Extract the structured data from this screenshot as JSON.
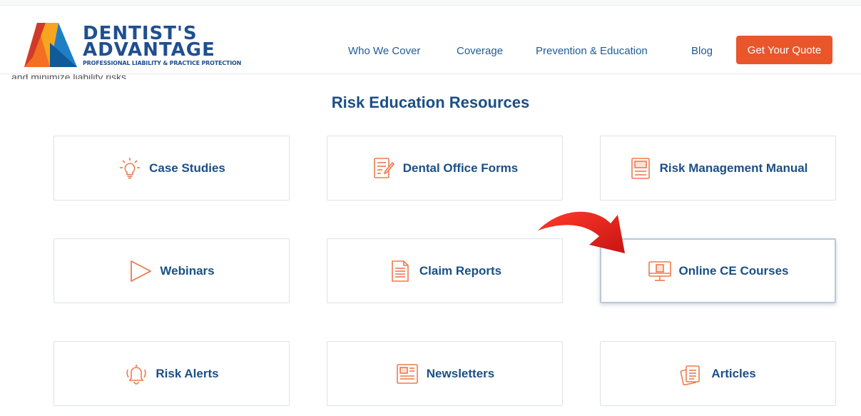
{
  "brand": {
    "line1": "DENTIST'S",
    "line2": "ADVANTAGE",
    "tagline": "PROFESSIONAL LIABILITY & PRACTICE PROTECTION"
  },
  "nav": {
    "items": [
      "Who We Cover",
      "Coverage",
      "Prevention & Education",
      "Blog"
    ],
    "cta": "Get Your Quote"
  },
  "peek_text": "and minimize liability risks.",
  "section_title": "Risk Education Resources",
  "cards": [
    {
      "label": "Case Studies",
      "icon": "lightbulb-icon"
    },
    {
      "label": "Dental Office Forms",
      "icon": "form-icon"
    },
    {
      "label": "Risk Management Manual",
      "icon": "manual-icon"
    },
    {
      "label": "Webinars",
      "icon": "play-icon"
    },
    {
      "label": "Claim Reports",
      "icon": "document-icon"
    },
    {
      "label": "Online CE Courses",
      "icon": "monitor-icon"
    },
    {
      "label": "Risk Alerts",
      "icon": "bell-icon"
    },
    {
      "label": "Newsletters",
      "icon": "newspaper-icon"
    },
    {
      "label": "Articles",
      "icon": "stacked-pages-icon"
    }
  ],
  "colors": {
    "accent": "#e8562a",
    "brand_blue": "#1b4f86",
    "card_border": "#dde2e8",
    "arrow": "#e02020"
  }
}
